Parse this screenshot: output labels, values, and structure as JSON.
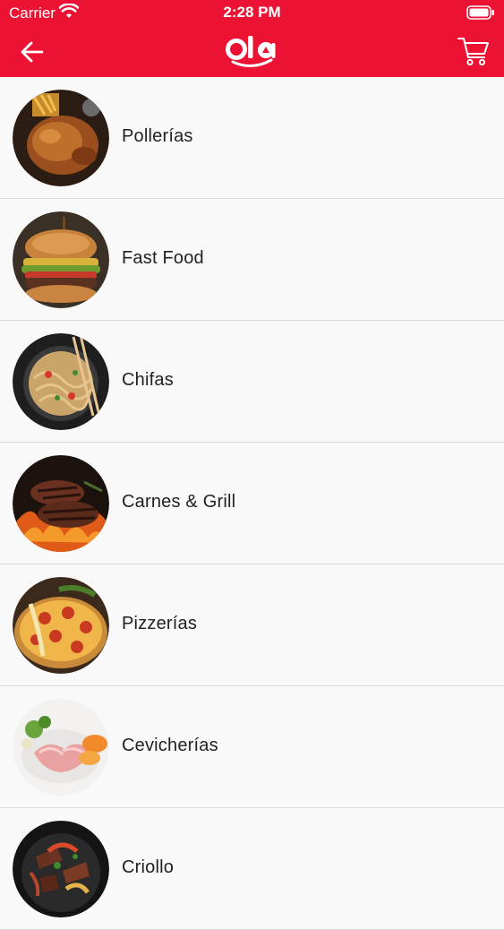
{
  "status_bar": {
    "carrier": "Carrier",
    "time": "2:28 PM"
  },
  "header": {
    "logo_text": "Ola",
    "back_icon": "arrow-left-icon",
    "cart_icon": "shopping-cart-icon",
    "background_color": "#ec1233"
  },
  "categories": [
    {
      "label": "Pollerías",
      "icon": "roast-chicken-image"
    },
    {
      "label": "Fast Food",
      "icon": "burger-image"
    },
    {
      "label": "Chifas",
      "icon": "noodles-image"
    },
    {
      "label": "Carnes & Grill",
      "icon": "grilled-steak-image"
    },
    {
      "label": "Pizzerías",
      "icon": "pizza-image"
    },
    {
      "label": "Cevicherías",
      "icon": "ceviche-image"
    },
    {
      "label": "Criollo",
      "icon": "lomo-saltado-image"
    }
  ]
}
